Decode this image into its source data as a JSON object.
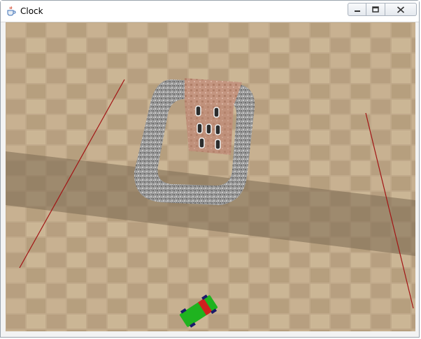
{
  "window": {
    "title": "Clock",
    "app_icon": "java-coffee-cup-icon",
    "controls": [
      {
        "name": "minimize-button",
        "icon": "minimize-icon"
      },
      {
        "name": "maximize-button",
        "icon": "maximize-icon"
      },
      {
        "name": "close-button",
        "icon": "close-icon"
      }
    ]
  },
  "scene": {
    "description_objects": [
      "tiled-floor",
      "track-ring",
      "building",
      "car",
      "guide-lines"
    ],
    "colors": {
      "floor_light": "#c4ad8e",
      "floor_mid": "#a98e70",
      "floor_dark_band": "#8e7a60",
      "track": "#8d8d8d",
      "building_roof": "#c9a595",
      "building_wall": "#b98a73",
      "car_body": "#1fb31f",
      "car_accent": "#d11f1f",
      "guide_line": "#a21414"
    }
  }
}
